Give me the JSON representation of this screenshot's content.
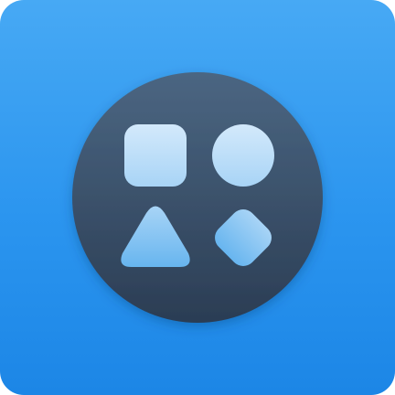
{
  "app_icon": {
    "name": "shapes-icon",
    "colors": {
      "background_top": "#47a9f4",
      "background_bottom": "#1c86e6",
      "badge_top": "#4b6682",
      "badge_bottom": "#2b3d54",
      "shape_light": "#d3e9fb",
      "shape_mid": "#a8d4f6",
      "shape_deep": "#67b5ef"
    },
    "shapes": [
      "square-shape",
      "circle-shape",
      "triangle-shape",
      "diamond-shape"
    ]
  }
}
